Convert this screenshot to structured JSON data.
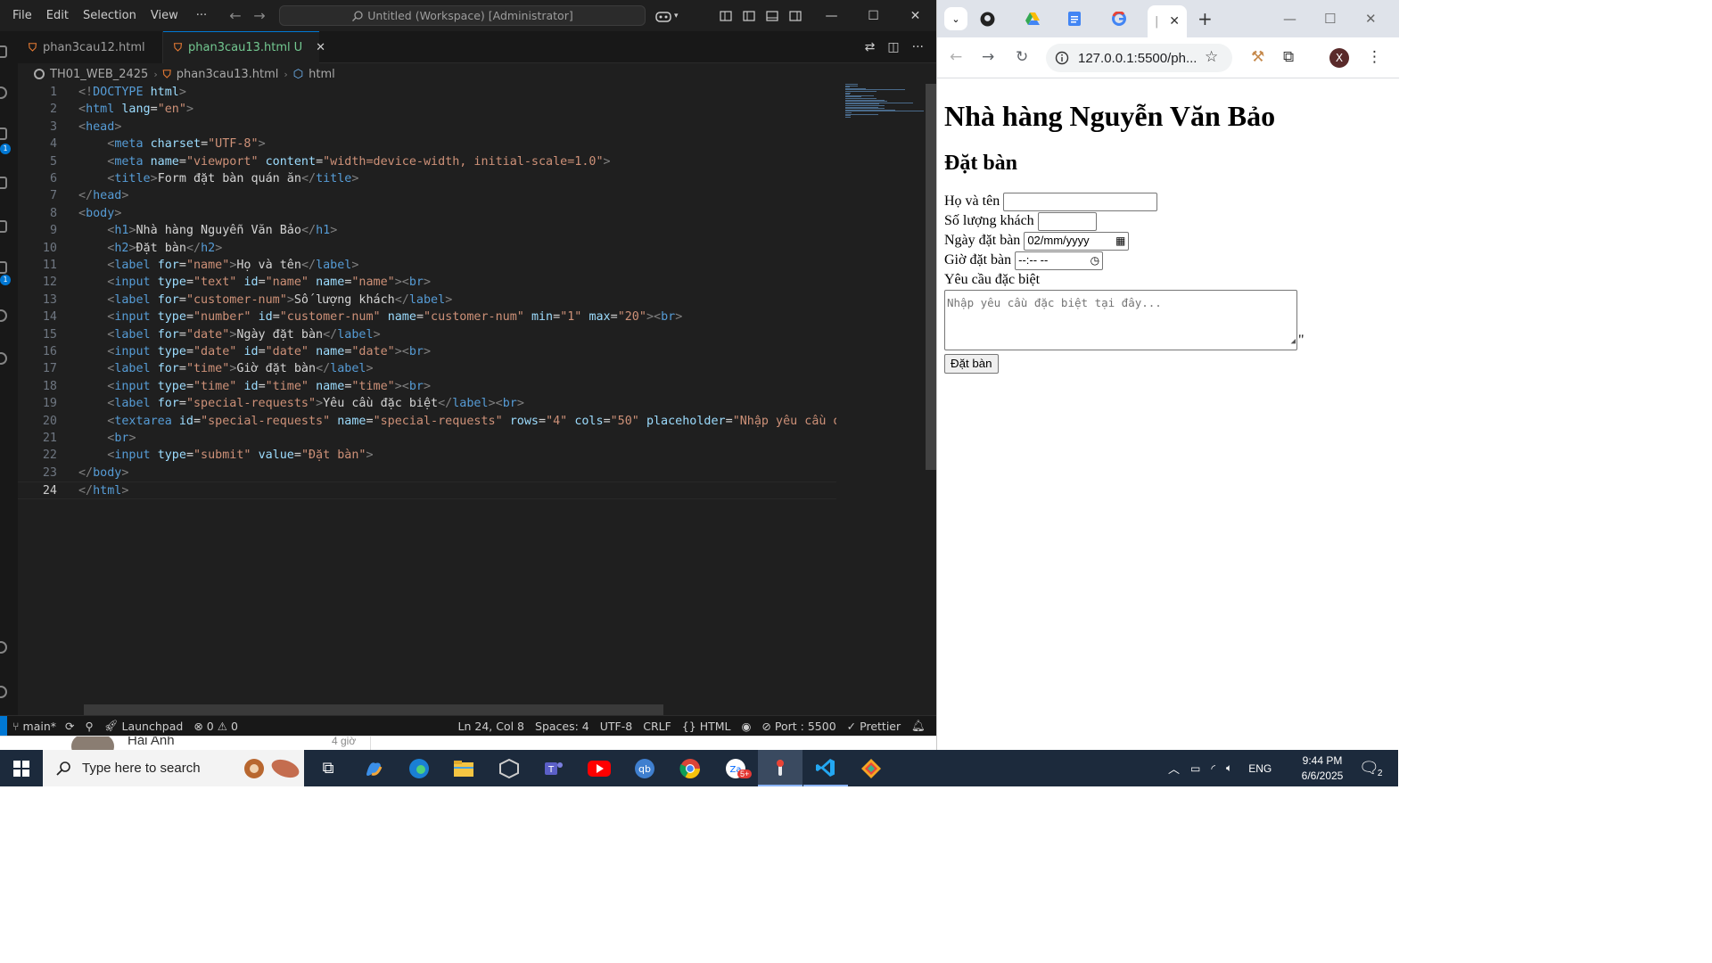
{
  "vscode": {
    "menu": [
      "File",
      "Edit",
      "Selection",
      "View",
      "···"
    ],
    "command_center": "Untitled (Workspace) [Administrator]",
    "tabs": [
      {
        "label": "phan3cau12.html",
        "active": false
      },
      {
        "label": "phan3cau13.html",
        "badge": "U",
        "active": true
      }
    ],
    "breadcrumb": [
      "TH01_WEB_2425",
      "phan3cau13.html",
      "html"
    ],
    "activity_badges": [
      "1",
      "1"
    ],
    "code_lines": [
      [
        {
          "c": "br",
          "t": "<!"
        },
        {
          "c": "tag",
          "t": "DOCTYPE"
        },
        {
          "c": "txt",
          "t": " "
        },
        {
          "c": "attr",
          "t": "html"
        },
        {
          "c": "br",
          "t": ">"
        }
      ],
      [
        {
          "c": "br",
          "t": "<"
        },
        {
          "c": "tag",
          "t": "html"
        },
        {
          "c": "txt",
          "t": " "
        },
        {
          "c": "attr",
          "t": "lang"
        },
        {
          "c": "txt",
          "t": "="
        },
        {
          "c": "str",
          "t": "\"en\""
        },
        {
          "c": "br",
          "t": ">"
        }
      ],
      [
        {
          "c": "br",
          "t": "<"
        },
        {
          "c": "tag",
          "t": "head"
        },
        {
          "c": "br",
          "t": ">"
        }
      ],
      [
        {
          "c": "txt",
          "t": "    "
        },
        {
          "c": "br",
          "t": "<"
        },
        {
          "c": "tag",
          "t": "meta"
        },
        {
          "c": "txt",
          "t": " "
        },
        {
          "c": "attr",
          "t": "charset"
        },
        {
          "c": "txt",
          "t": "="
        },
        {
          "c": "str",
          "t": "\"UTF-8\""
        },
        {
          "c": "br",
          "t": ">"
        }
      ],
      [
        {
          "c": "txt",
          "t": "    "
        },
        {
          "c": "br",
          "t": "<"
        },
        {
          "c": "tag",
          "t": "meta"
        },
        {
          "c": "txt",
          "t": " "
        },
        {
          "c": "attr",
          "t": "name"
        },
        {
          "c": "txt",
          "t": "="
        },
        {
          "c": "str",
          "t": "\"viewport\""
        },
        {
          "c": "txt",
          "t": " "
        },
        {
          "c": "attr",
          "t": "content"
        },
        {
          "c": "txt",
          "t": "="
        },
        {
          "c": "str",
          "t": "\"width=device-width, initial-scale=1.0\""
        },
        {
          "c": "br",
          "t": ">"
        }
      ],
      [
        {
          "c": "txt",
          "t": "    "
        },
        {
          "c": "br",
          "t": "<"
        },
        {
          "c": "tag",
          "t": "title"
        },
        {
          "c": "br",
          "t": ">"
        },
        {
          "c": "txt",
          "t": "Form đặt bàn quán ăn"
        },
        {
          "c": "br",
          "t": "</"
        },
        {
          "c": "tag",
          "t": "title"
        },
        {
          "c": "br",
          "t": ">"
        }
      ],
      [
        {
          "c": "br",
          "t": "</"
        },
        {
          "c": "tag",
          "t": "head"
        },
        {
          "c": "br",
          "t": ">"
        }
      ],
      [
        {
          "c": "br",
          "t": "<"
        },
        {
          "c": "tag",
          "t": "body"
        },
        {
          "c": "br",
          "t": ">"
        }
      ],
      [
        {
          "c": "txt",
          "t": "    "
        },
        {
          "c": "br",
          "t": "<"
        },
        {
          "c": "tag",
          "t": "h1"
        },
        {
          "c": "br",
          "t": ">"
        },
        {
          "c": "txt",
          "t": "Nhà hàng Nguyễn Văn Bảo"
        },
        {
          "c": "br",
          "t": "</"
        },
        {
          "c": "tag",
          "t": "h1"
        },
        {
          "c": "br",
          "t": ">"
        }
      ],
      [
        {
          "c": "txt",
          "t": "    "
        },
        {
          "c": "br",
          "t": "<"
        },
        {
          "c": "tag",
          "t": "h2"
        },
        {
          "c": "br",
          "t": ">"
        },
        {
          "c": "txt",
          "t": "Đặt bàn"
        },
        {
          "c": "br",
          "t": "</"
        },
        {
          "c": "tag",
          "t": "h2"
        },
        {
          "c": "br",
          "t": ">"
        }
      ],
      [
        {
          "c": "txt",
          "t": "    "
        },
        {
          "c": "br",
          "t": "<"
        },
        {
          "c": "tag",
          "t": "label"
        },
        {
          "c": "txt",
          "t": " "
        },
        {
          "c": "attr",
          "t": "for"
        },
        {
          "c": "txt",
          "t": "="
        },
        {
          "c": "str",
          "t": "\"name\""
        },
        {
          "c": "br",
          "t": ">"
        },
        {
          "c": "txt",
          "t": "Họ và tên"
        },
        {
          "c": "br",
          "t": "</"
        },
        {
          "c": "tag",
          "t": "label"
        },
        {
          "c": "br",
          "t": ">"
        }
      ],
      [
        {
          "c": "txt",
          "t": "    "
        },
        {
          "c": "br",
          "t": "<"
        },
        {
          "c": "tag",
          "t": "input"
        },
        {
          "c": "txt",
          "t": " "
        },
        {
          "c": "attr",
          "t": "type"
        },
        {
          "c": "txt",
          "t": "="
        },
        {
          "c": "str",
          "t": "\"text\""
        },
        {
          "c": "txt",
          "t": " "
        },
        {
          "c": "attr",
          "t": "id"
        },
        {
          "c": "txt",
          "t": "="
        },
        {
          "c": "str",
          "t": "\"name\""
        },
        {
          "c": "txt",
          "t": " "
        },
        {
          "c": "attr",
          "t": "name"
        },
        {
          "c": "txt",
          "t": "="
        },
        {
          "c": "str",
          "t": "\"name\""
        },
        {
          "c": "br",
          "t": "><"
        },
        {
          "c": "tag",
          "t": "br"
        },
        {
          "c": "br",
          "t": ">"
        }
      ],
      [
        {
          "c": "txt",
          "t": "    "
        },
        {
          "c": "br",
          "t": "<"
        },
        {
          "c": "tag",
          "t": "label"
        },
        {
          "c": "txt",
          "t": " "
        },
        {
          "c": "attr",
          "t": "for"
        },
        {
          "c": "txt",
          "t": "="
        },
        {
          "c": "str",
          "t": "\"customer-num\""
        },
        {
          "c": "br",
          "t": ">"
        },
        {
          "c": "txt",
          "t": "Số lượng khách"
        },
        {
          "c": "br",
          "t": "</"
        },
        {
          "c": "tag",
          "t": "label"
        },
        {
          "c": "br",
          "t": ">"
        }
      ],
      [
        {
          "c": "txt",
          "t": "    "
        },
        {
          "c": "br",
          "t": "<"
        },
        {
          "c": "tag",
          "t": "input"
        },
        {
          "c": "txt",
          "t": " "
        },
        {
          "c": "attr",
          "t": "type"
        },
        {
          "c": "txt",
          "t": "="
        },
        {
          "c": "str",
          "t": "\"number\""
        },
        {
          "c": "txt",
          "t": " "
        },
        {
          "c": "attr",
          "t": "id"
        },
        {
          "c": "txt",
          "t": "="
        },
        {
          "c": "str",
          "t": "\"customer-num\""
        },
        {
          "c": "txt",
          "t": " "
        },
        {
          "c": "attr",
          "t": "name"
        },
        {
          "c": "txt",
          "t": "="
        },
        {
          "c": "str",
          "t": "\"customer-num\""
        },
        {
          "c": "txt",
          "t": " "
        },
        {
          "c": "attr",
          "t": "min"
        },
        {
          "c": "txt",
          "t": "="
        },
        {
          "c": "str",
          "t": "\"1\""
        },
        {
          "c": "txt",
          "t": " "
        },
        {
          "c": "attr",
          "t": "max"
        },
        {
          "c": "txt",
          "t": "="
        },
        {
          "c": "str",
          "t": "\"20\""
        },
        {
          "c": "br",
          "t": "><"
        },
        {
          "c": "tag",
          "t": "br"
        },
        {
          "c": "br",
          "t": ">"
        }
      ],
      [
        {
          "c": "txt",
          "t": "    "
        },
        {
          "c": "br",
          "t": "<"
        },
        {
          "c": "tag",
          "t": "label"
        },
        {
          "c": "txt",
          "t": " "
        },
        {
          "c": "attr",
          "t": "for"
        },
        {
          "c": "txt",
          "t": "="
        },
        {
          "c": "str",
          "t": "\"date\""
        },
        {
          "c": "br",
          "t": ">"
        },
        {
          "c": "txt",
          "t": "Ngày đặt bàn"
        },
        {
          "c": "br",
          "t": "</"
        },
        {
          "c": "tag",
          "t": "label"
        },
        {
          "c": "br",
          "t": ">"
        }
      ],
      [
        {
          "c": "txt",
          "t": "    "
        },
        {
          "c": "br",
          "t": "<"
        },
        {
          "c": "tag",
          "t": "input"
        },
        {
          "c": "txt",
          "t": " "
        },
        {
          "c": "attr",
          "t": "type"
        },
        {
          "c": "txt",
          "t": "="
        },
        {
          "c": "str",
          "t": "\"date\""
        },
        {
          "c": "txt",
          "t": " "
        },
        {
          "c": "attr",
          "t": "id"
        },
        {
          "c": "txt",
          "t": "="
        },
        {
          "c": "str",
          "t": "\"date\""
        },
        {
          "c": "txt",
          "t": " "
        },
        {
          "c": "attr",
          "t": "name"
        },
        {
          "c": "txt",
          "t": "="
        },
        {
          "c": "str",
          "t": "\"date\""
        },
        {
          "c": "br",
          "t": "><"
        },
        {
          "c": "tag",
          "t": "br"
        },
        {
          "c": "br",
          "t": ">"
        }
      ],
      [
        {
          "c": "txt",
          "t": "    "
        },
        {
          "c": "br",
          "t": "<"
        },
        {
          "c": "tag",
          "t": "label"
        },
        {
          "c": "txt",
          "t": " "
        },
        {
          "c": "attr",
          "t": "for"
        },
        {
          "c": "txt",
          "t": "="
        },
        {
          "c": "str",
          "t": "\"time\""
        },
        {
          "c": "br",
          "t": ">"
        },
        {
          "c": "txt",
          "t": "Giờ đặt bàn"
        },
        {
          "c": "br",
          "t": "</"
        },
        {
          "c": "tag",
          "t": "label"
        },
        {
          "c": "br",
          "t": ">"
        }
      ],
      [
        {
          "c": "txt",
          "t": "    "
        },
        {
          "c": "br",
          "t": "<"
        },
        {
          "c": "tag",
          "t": "input"
        },
        {
          "c": "txt",
          "t": " "
        },
        {
          "c": "attr",
          "t": "type"
        },
        {
          "c": "txt",
          "t": "="
        },
        {
          "c": "str",
          "t": "\"time\""
        },
        {
          "c": "txt",
          "t": " "
        },
        {
          "c": "attr",
          "t": "id"
        },
        {
          "c": "txt",
          "t": "="
        },
        {
          "c": "str",
          "t": "\"time\""
        },
        {
          "c": "txt",
          "t": " "
        },
        {
          "c": "attr",
          "t": "name"
        },
        {
          "c": "txt",
          "t": "="
        },
        {
          "c": "str",
          "t": "\"time\""
        },
        {
          "c": "br",
          "t": "><"
        },
        {
          "c": "tag",
          "t": "br"
        },
        {
          "c": "br",
          "t": ">"
        }
      ],
      [
        {
          "c": "txt",
          "t": "    "
        },
        {
          "c": "br",
          "t": "<"
        },
        {
          "c": "tag",
          "t": "label"
        },
        {
          "c": "txt",
          "t": " "
        },
        {
          "c": "attr",
          "t": "for"
        },
        {
          "c": "txt",
          "t": "="
        },
        {
          "c": "str",
          "t": "\"special-requests\""
        },
        {
          "c": "br",
          "t": ">"
        },
        {
          "c": "txt",
          "t": "Yêu cầu đặc biệt"
        },
        {
          "c": "br",
          "t": "</"
        },
        {
          "c": "tag",
          "t": "label"
        },
        {
          "c": "br",
          "t": "><"
        },
        {
          "c": "tag",
          "t": "br"
        },
        {
          "c": "br",
          "t": ">"
        }
      ],
      [
        {
          "c": "txt",
          "t": "    "
        },
        {
          "c": "br",
          "t": "<"
        },
        {
          "c": "tag",
          "t": "textarea"
        },
        {
          "c": "txt",
          "t": " "
        },
        {
          "c": "attr",
          "t": "id"
        },
        {
          "c": "txt",
          "t": "="
        },
        {
          "c": "str",
          "t": "\"special-requests\""
        },
        {
          "c": "txt",
          "t": " "
        },
        {
          "c": "attr",
          "t": "name"
        },
        {
          "c": "txt",
          "t": "="
        },
        {
          "c": "str",
          "t": "\"special-requests\""
        },
        {
          "c": "txt",
          "t": " "
        },
        {
          "c": "attr",
          "t": "rows"
        },
        {
          "c": "txt",
          "t": "="
        },
        {
          "c": "str",
          "t": "\"4\""
        },
        {
          "c": "txt",
          "t": " "
        },
        {
          "c": "attr",
          "t": "cols"
        },
        {
          "c": "txt",
          "t": "="
        },
        {
          "c": "str",
          "t": "\"50\""
        },
        {
          "c": "txt",
          "t": " "
        },
        {
          "c": "attr",
          "t": "placeholder"
        },
        {
          "c": "txt",
          "t": "="
        },
        {
          "c": "str",
          "t": "\"Nhập yêu cầu đặc"
        }
      ],
      [
        {
          "c": "txt",
          "t": "    "
        },
        {
          "c": "br",
          "t": "<"
        },
        {
          "c": "tag",
          "t": "br"
        },
        {
          "c": "br",
          "t": ">"
        }
      ],
      [
        {
          "c": "txt",
          "t": "    "
        },
        {
          "c": "br",
          "t": "<"
        },
        {
          "c": "tag",
          "t": "input"
        },
        {
          "c": "txt",
          "t": " "
        },
        {
          "c": "attr",
          "t": "type"
        },
        {
          "c": "txt",
          "t": "="
        },
        {
          "c": "str",
          "t": "\"submit\""
        },
        {
          "c": "txt",
          "t": " "
        },
        {
          "c": "attr",
          "t": "value"
        },
        {
          "c": "txt",
          "t": "="
        },
        {
          "c": "str",
          "t": "\"Đặt bàn\""
        },
        {
          "c": "br",
          "t": ">"
        }
      ],
      [
        {
          "c": "br",
          "t": "</"
        },
        {
          "c": "tag",
          "t": "body"
        },
        {
          "c": "br",
          "t": ">"
        }
      ],
      [
        {
          "c": "br",
          "t": "</"
        },
        {
          "c": "tag",
          "t": "html"
        },
        {
          "c": "br",
          "t": ">"
        }
      ]
    ],
    "current_line": 24,
    "status": {
      "branch": "main*",
      "launchpad": "Launchpad",
      "errors": "0",
      "warnings": "0",
      "cursor": "Ln 24, Col 8",
      "spaces": "Spaces: 4",
      "encoding": "UTF-8",
      "eol": "CRLF",
      "language": "HTML",
      "port": "Port : 5500",
      "prettier": "Prettier"
    },
    "colors": {
      "accent": "#0078d4",
      "tag": "#569cd6",
      "attr": "#9cdcfe",
      "string": "#ce9178",
      "bracket": "#808080",
      "untracked": "#73c991"
    }
  },
  "chrome": {
    "url": "127.0.0.1:5500/ph...",
    "avatar": "X",
    "page": {
      "h1": "Nhà hàng Nguyễn Văn Bảo",
      "h2": "Đặt bàn",
      "label_name": "Họ và tên",
      "label_guests": "Số lượng khách",
      "label_date": "Ngày đặt bàn",
      "date_value": "02/mm/yyyy",
      "label_time": "Giờ đặt bàn",
      "time_value": "--:-- --",
      "label_requests": "Yêu cầu đặc biệt",
      "textarea_placeholder": "Nhập yêu cầu đặc biệt tại đây...",
      "stray_char": "\"",
      "submit": "Đặt bàn"
    }
  },
  "taskbar": {
    "search_placeholder": "Type here to search",
    "teams_name": "Hải Anh",
    "teams_time": "4 giờ",
    "zalo_badge": "5+",
    "language": "ENG",
    "time": "9:44 PM",
    "date": "6/6/2025",
    "notification_count": "2"
  }
}
